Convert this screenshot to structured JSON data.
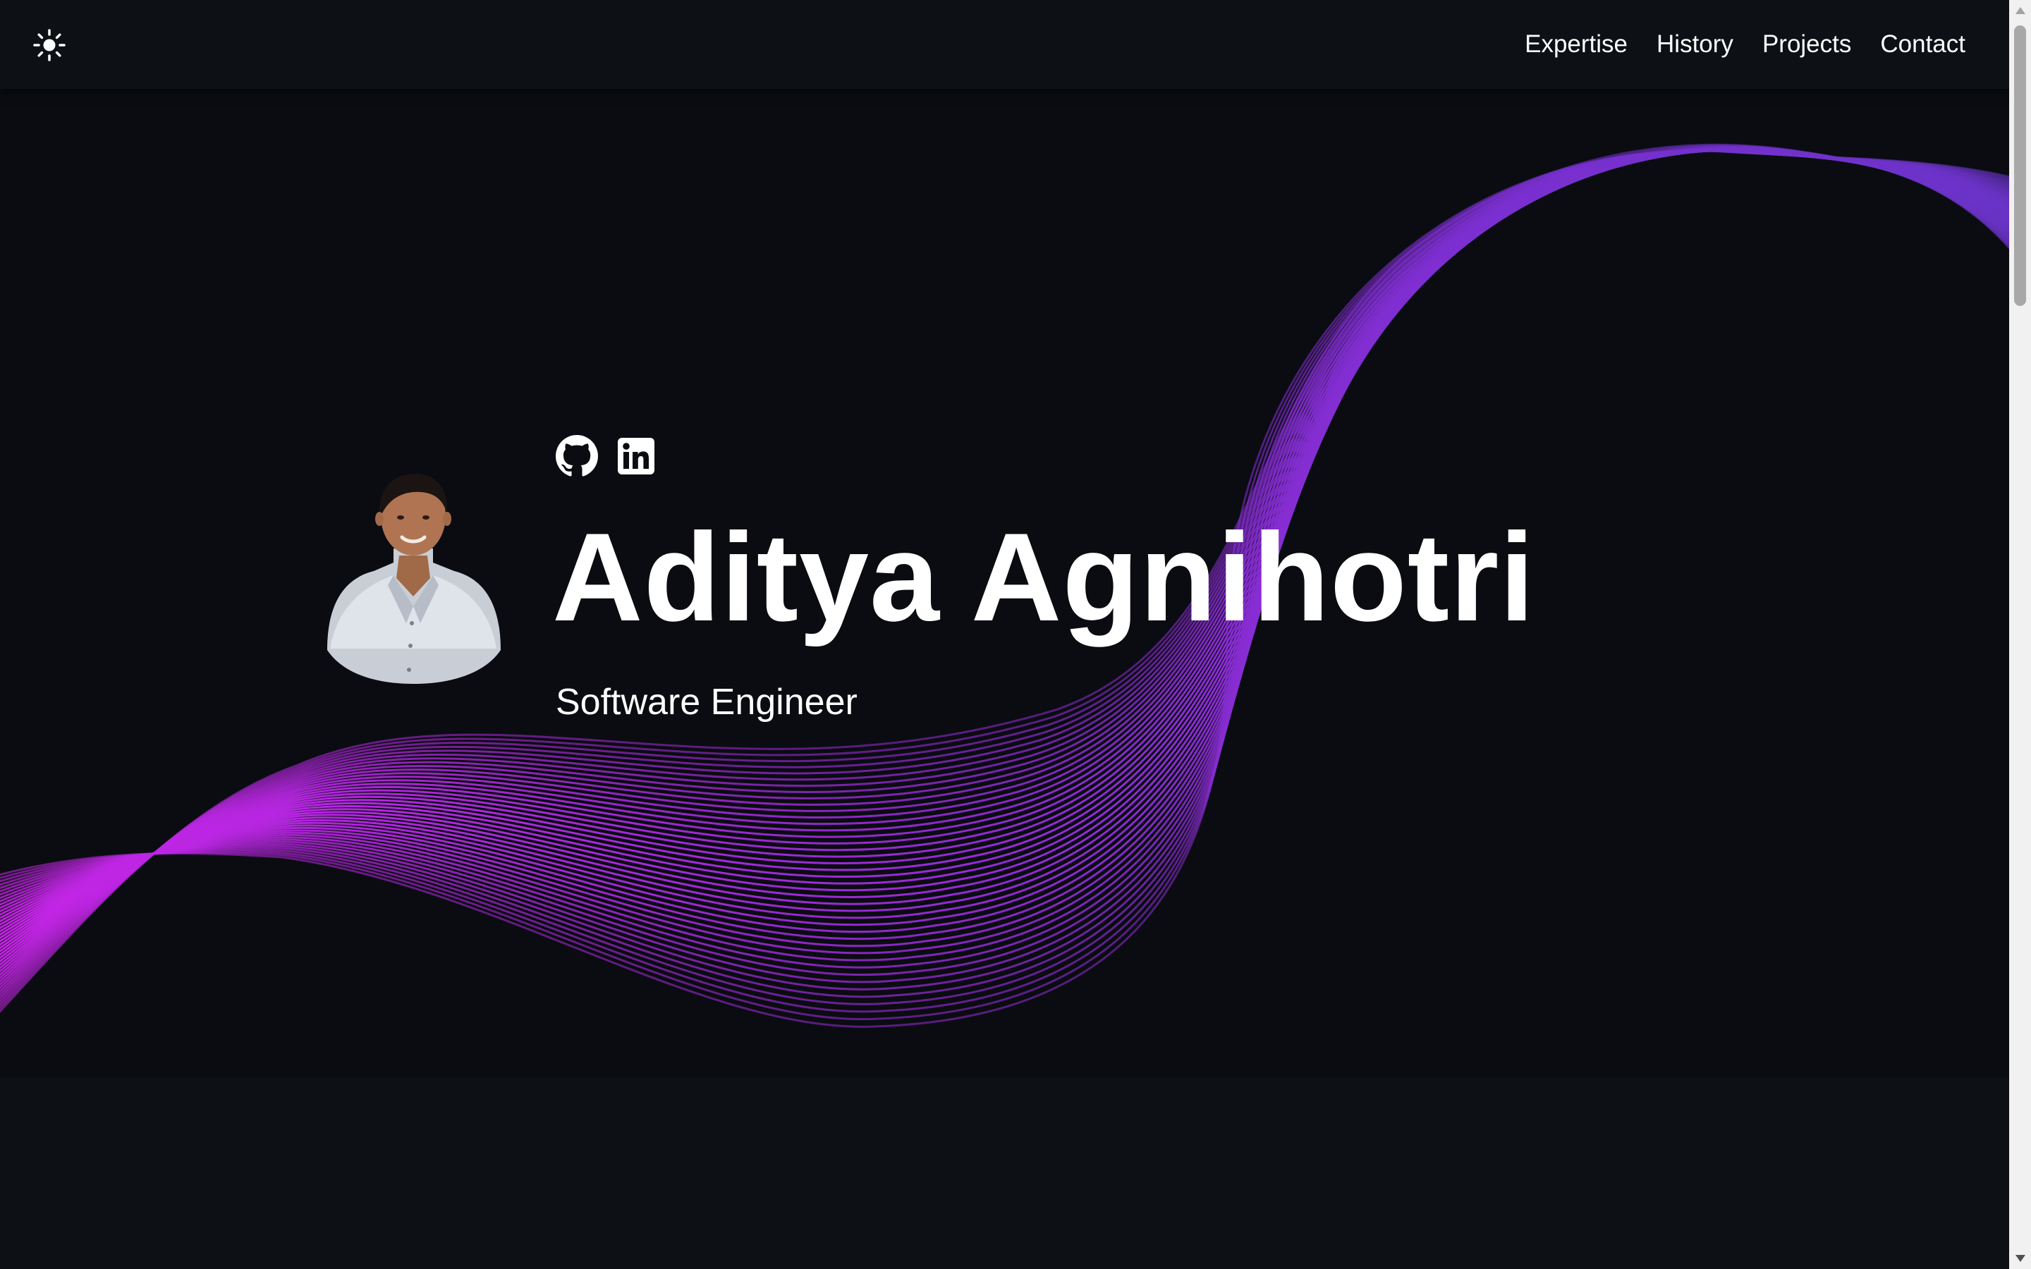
{
  "nav": {
    "theme_toggle_icon": "sun-icon",
    "links": [
      "Expertise",
      "History",
      "Projects",
      "Contact"
    ]
  },
  "hero": {
    "name": "Aditya Agnihotri",
    "role": "Software Engineer",
    "social": [
      {
        "icon": "github-icon"
      },
      {
        "icon": "linkedin-icon"
      }
    ],
    "avatar_icon": "profile-photo"
  },
  "colors": {
    "background": "#0a0c11",
    "navbar": "#0d1116",
    "wave_violet": "#7a2fd0",
    "wave_magenta": "#c425e6",
    "text": "#ffffff"
  }
}
